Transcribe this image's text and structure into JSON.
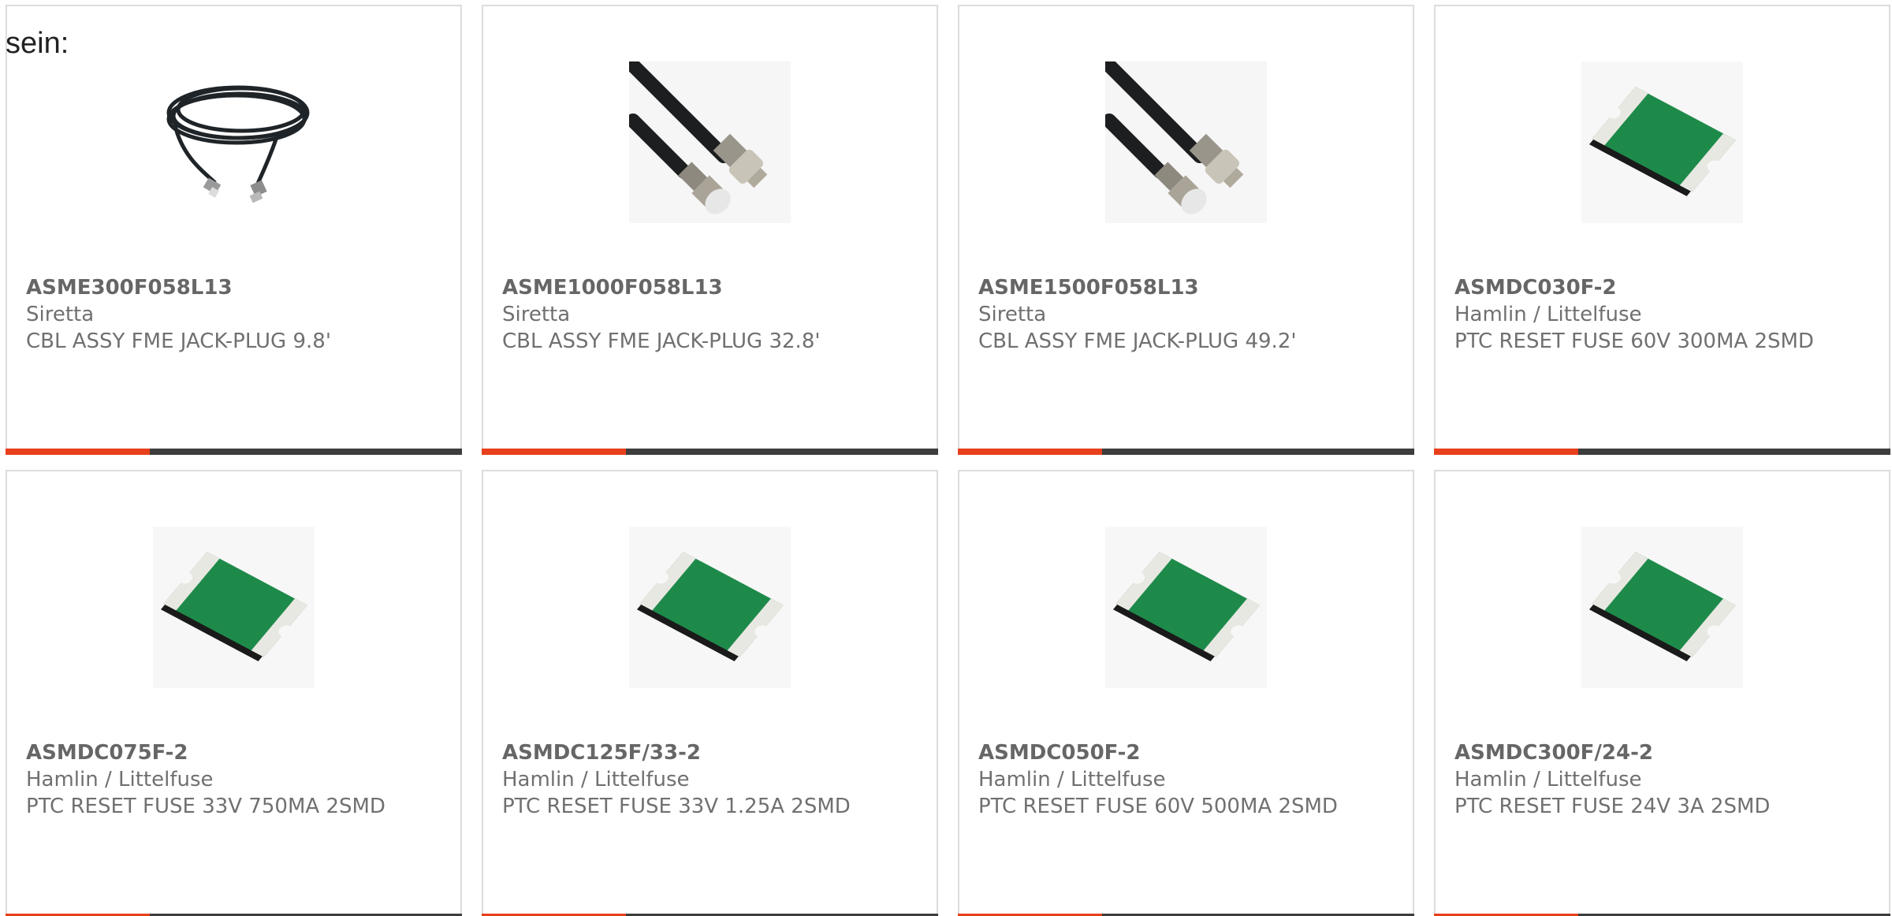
{
  "intro_text": "sein:",
  "colors": {
    "accent": "#e8401c",
    "bar_dark": "#3d3d3d",
    "card_border": "#dcdcdc"
  },
  "products": [
    {
      "part_number": "ASME300F058L13",
      "manufacturer": "Siretta",
      "description": "CBL ASSY FME JACK-PLUG 9.8'",
      "image": "coiled-cable-icon"
    },
    {
      "part_number": "ASME1000F058L13",
      "manufacturer": "Siretta",
      "description": "CBL ASSY FME JACK-PLUG 32.8'",
      "image": "fme-cable-connector-icon"
    },
    {
      "part_number": "ASME1500F058L13",
      "manufacturer": "Siretta",
      "description": "CBL ASSY FME JACK-PLUG 49.2'",
      "image": "fme-cable-connector-icon"
    },
    {
      "part_number": "ASMDC030F-2",
      "manufacturer": "Hamlin / Littelfuse",
      "description": "PTC RESET FUSE 60V 300MA 2SMD",
      "image": "smd-fuse-icon"
    },
    {
      "part_number": "ASMDC075F-2",
      "manufacturer": "Hamlin / Littelfuse",
      "description": "PTC RESET FUSE 33V 750MA 2SMD",
      "image": "smd-fuse-icon"
    },
    {
      "part_number": "ASMDC125F/33-2",
      "manufacturer": "Hamlin / Littelfuse",
      "description": "PTC RESET FUSE 33V 1.25A 2SMD",
      "image": "smd-fuse-icon"
    },
    {
      "part_number": "ASMDC050F-2",
      "manufacturer": "Hamlin / Littelfuse",
      "description": "PTC RESET FUSE 60V 500MA 2SMD",
      "image": "smd-fuse-icon"
    },
    {
      "part_number": "ASMDC300F/24-2",
      "manufacturer": "Hamlin / Littelfuse",
      "description": "PTC RESET FUSE 24V 3A 2SMD",
      "image": "smd-fuse-icon"
    }
  ]
}
